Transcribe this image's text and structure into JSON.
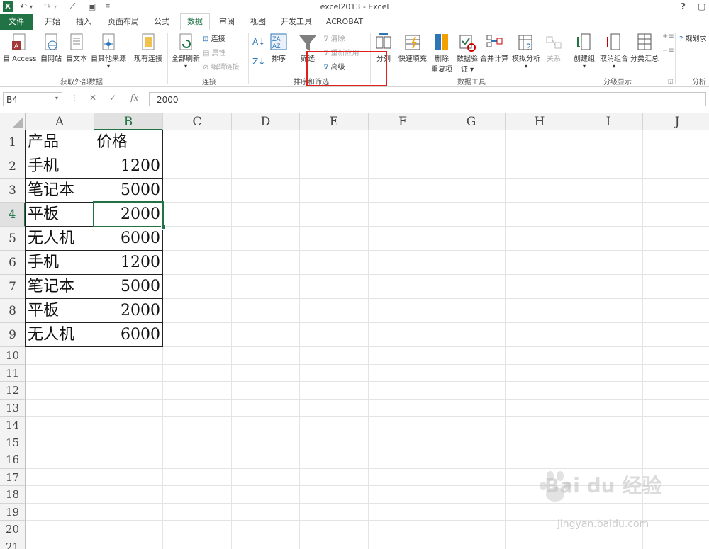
{
  "window": {
    "title": "excel2013 - Excel",
    "help": "?",
    "controls": [
      "□",
      "–"
    ]
  },
  "tabs": [
    {
      "label": "文件",
      "active": false,
      "file": true
    },
    {
      "label": "开始",
      "active": false
    },
    {
      "label": "插入",
      "active": false
    },
    {
      "label": "页面布局",
      "active": false
    },
    {
      "label": "公式",
      "active": false
    },
    {
      "label": "数据",
      "active": true
    },
    {
      "label": "审阅",
      "active": false
    },
    {
      "label": "视图",
      "active": false
    },
    {
      "label": "开发工具",
      "active": false
    },
    {
      "label": "ACROBAT",
      "active": false
    }
  ],
  "ribbon": {
    "external_data": {
      "group_label": "获取外部数据",
      "access": "自 Access",
      "web": "自网站",
      "text": "自文本",
      "other": "自其他来源",
      "existing": "现有连接"
    },
    "connections": {
      "group_label": "连接",
      "refresh_all": "全部刷新",
      "connections": "连接",
      "properties": "属性",
      "edit_links": "编辑链接"
    },
    "sort_filter": {
      "group_label": "排序和筛选",
      "sort": "排序",
      "filter": "筛选",
      "clear": "清除",
      "reapply": "重新应用",
      "advanced": "高级"
    },
    "data_tools": {
      "group_label": "数据工具",
      "text_to_columns": "分列",
      "flash_fill": "快速填充",
      "remove_dup_1": "删除",
      "remove_dup_2": "重复项",
      "validation_1": "数据验",
      "validation_2": "证",
      "consolidate": "合并计算",
      "what_if": "模拟分析",
      "relationships": "关系"
    },
    "outline": {
      "group_label": "分级显示",
      "group": "创建组",
      "ungroup": "取消组合",
      "subtotal": "分类汇总"
    },
    "analysis": {
      "solver": "规划求",
      "group_label": "分析"
    }
  },
  "formula_bar": {
    "name_box": "B4",
    "fx": "fx",
    "value": "2000"
  },
  "columns": [
    "A",
    "B",
    "C",
    "D",
    "E",
    "F",
    "G",
    "H",
    "I",
    "J"
  ],
  "selected_column": "B",
  "rows": [
    "1",
    "2",
    "3",
    "4",
    "5",
    "6",
    "7",
    "8",
    "9",
    "10",
    "11",
    "12",
    "13",
    "14",
    "15",
    "16",
    "17",
    "18",
    "19",
    "20",
    "21"
  ],
  "selected_row": "4",
  "cells": [
    {
      "product": "产品",
      "price": "价格"
    },
    {
      "product": "手机",
      "price": "1200"
    },
    {
      "product": "笔记本",
      "price": "5000"
    },
    {
      "product": "平板",
      "price": "2000"
    },
    {
      "product": "无人机",
      "price": "6000"
    },
    {
      "product": "手机",
      "price": "1200"
    },
    {
      "product": "笔记本",
      "price": "5000"
    },
    {
      "product": "平板",
      "price": "2000"
    },
    {
      "product": "无人机",
      "price": "6000"
    }
  ],
  "watermark": {
    "brand": "Bai du 经验",
    "url": "jingyan.baidu.com"
  },
  "colors": {
    "excel_green": "#217346",
    "highlight_red": "#e0201b"
  }
}
